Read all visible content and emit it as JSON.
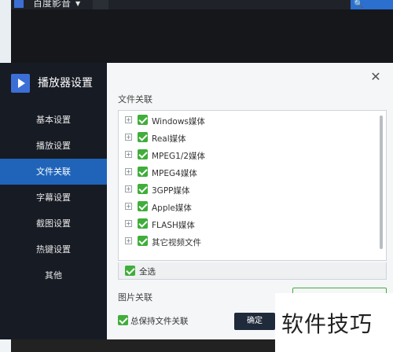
{
  "background_window": {
    "title": "百度影音"
  },
  "dialog": {
    "title": "播放器设置",
    "sidebar": {
      "items": [
        {
          "label": "基本设置"
        },
        {
          "label": "播放设置"
        },
        {
          "label": "文件关联",
          "active": true
        },
        {
          "label": "字幕设置"
        },
        {
          "label": "截图设置"
        },
        {
          "label": "热键设置"
        },
        {
          "label": "其他"
        }
      ]
    },
    "file_association": {
      "section_title": "文件关联",
      "items": [
        {
          "label": "Windows媒体",
          "checked": true
        },
        {
          "label": "Real媒体",
          "checked": true
        },
        {
          "label": "MPEG1/2媒体",
          "checked": true
        },
        {
          "label": "MPEG4媒体",
          "checked": true
        },
        {
          "label": "3GPP媒体",
          "checked": true
        },
        {
          "label": "Apple媒体",
          "checked": true
        },
        {
          "label": "FLASH媒体",
          "checked": true
        },
        {
          "label": "其它视频文件",
          "checked": true
        }
      ],
      "select_all_label": "全选",
      "select_all_checked": true
    },
    "image_association": {
      "section_title": "图片关联"
    },
    "keep_association_label": "总保持文件关联",
    "keep_association_checked": true,
    "ok_label": "确定"
  },
  "watermark": {
    "text": "软件技巧"
  },
  "colors": {
    "sidebar_bg": "#171b24",
    "active_item": "#1f64b8",
    "checkbox_green": "#3fae3a",
    "ok_button": "#1f2a3b"
  }
}
